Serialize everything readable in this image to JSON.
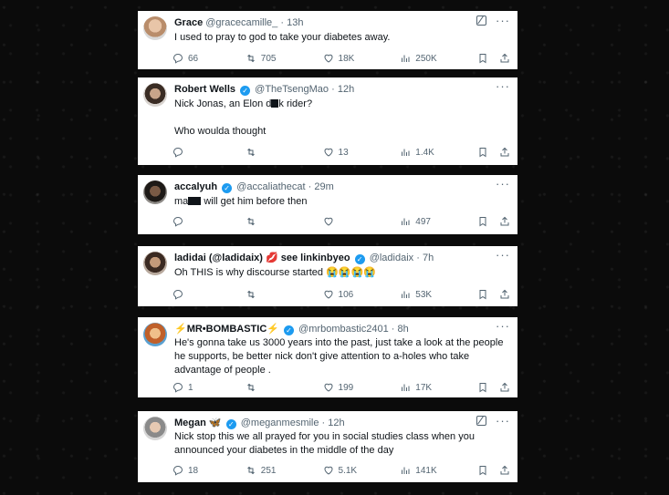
{
  "tweets": [
    {
      "name": "Grace",
      "badge": "",
      "handle": "@gracecamille_",
      "time": "13h",
      "lines": [
        "I used to pray to god to take your diabetes away."
      ],
      "replies": "66",
      "retweets": "705",
      "likes": "18K",
      "views": "250K",
      "grok": true
    },
    {
      "name": "Robert Wells",
      "badge": "✓",
      "handle": "@TheTsengMao",
      "time": "12h",
      "lines": [
        "Nick Jonas, an Elon d",
        "k rider?",
        "",
        "Who woulda thought"
      ],
      "replies": "",
      "retweets": "",
      "likes": "13",
      "views": "1.4K",
      "grok": false
    },
    {
      "name": "accalyuh",
      "badge": "✓",
      "handle": "@accaliathecat",
      "time": "29m",
      "lines": [
        "ma",
        "will get him before then"
      ],
      "replies": "",
      "retweets": "",
      "likes": "",
      "views": "497",
      "grok": false
    },
    {
      "name": "ladidai (@ladidaix)",
      "name_emoji": "💋",
      "name_suffix": "see linkinbyeo",
      "badge": "✓",
      "handle": "@ladidaix",
      "time": "7h",
      "lines": [
        "Oh THIS is why discourse started",
        "😭😭😭😭"
      ],
      "replies": "",
      "retweets": "",
      "likes": "106",
      "views": "53K",
      "grok": false
    },
    {
      "name": "⚡MR•BOMBASTIC⚡",
      "badge": "✓",
      "handle": "@mrbombastic2401",
      "time": "8h",
      "lines": [
        "He's gonna take us 3000 years into the past, just take a look at the people",
        "he supports, be better nick don't give attention to a-holes who take",
        "advantage of people ."
      ],
      "replies": "1",
      "retweets": "",
      "likes": "199",
      "views": "17K",
      "grok": false
    },
    {
      "name": "Megan",
      "name_emoji": "🦋",
      "badge": "✓",
      "handle": "@meganmesmile",
      "time": "12h",
      "lines": [
        "Nick stop this we all prayed for you in social studies class when you",
        "announced your diabetes in the middle of the day"
      ],
      "replies": "18",
      "retweets": "251",
      "likes": "5.1K",
      "views": "141K",
      "grok": true
    }
  ],
  "colors": {
    "accent": "#1d9bf0",
    "muted": "#536471",
    "text": "#0f1419",
    "background": "#0b0b0b"
  }
}
